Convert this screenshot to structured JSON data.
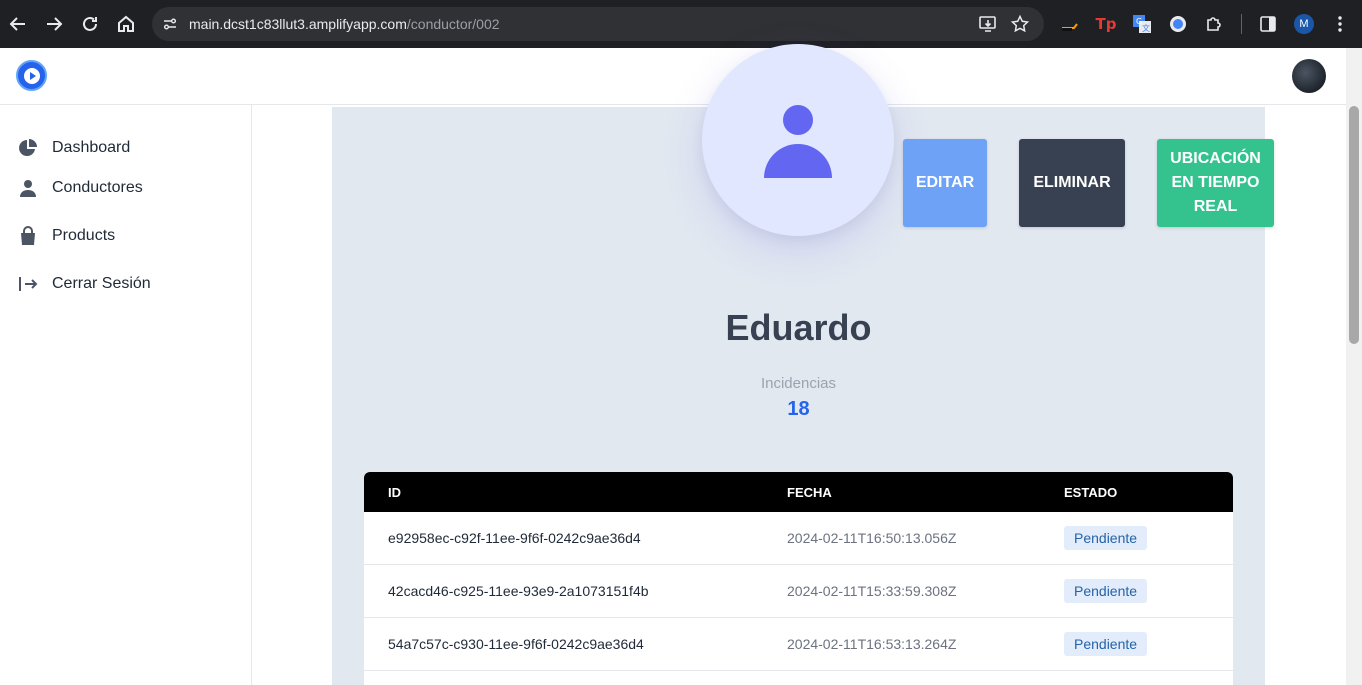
{
  "browser": {
    "url_host": "main.dcst1c83llut3.amplifyapp.com",
    "url_path": "/conductor/002",
    "profile_initial": "M"
  },
  "header": {
    "logo_icon": "play-logo-icon",
    "avatar_icon": "user-avatar"
  },
  "sidebar": {
    "items": [
      {
        "label": "Dashboard",
        "icon": "pie-chart-icon"
      },
      {
        "label": "Conductores",
        "icon": "user-icon"
      },
      {
        "label": "Products",
        "icon": "shopping-bag-icon"
      },
      {
        "label": "Cerrar Sesión",
        "icon": "logout-icon"
      }
    ]
  },
  "driver": {
    "name": "Eduardo",
    "incidents_label": "Incidencias",
    "incidents_value": "18"
  },
  "actions": {
    "edit": "EDITAR",
    "delete": "ELIMINAR",
    "location": "UBICACIÓN EN TIEMPO REAL"
  },
  "table": {
    "headers": [
      "ID",
      "FECHA",
      "ESTADO"
    ],
    "rows": [
      {
        "id": "e92958ec-c92f-11ee-9f6f-0242c9ae36d4",
        "date": "2024-02-11T16:50:13.056Z",
        "status": "Pendiente"
      },
      {
        "id": "42cacd46-c925-11ee-93e9-2a1073151f4b",
        "date": "2024-02-11T15:33:59.308Z",
        "status": "Pendiente"
      },
      {
        "id": "54a7c57c-c930-11ee-9f6f-0242c9ae36d4",
        "date": "2024-02-11T16:53:13.264Z",
        "status": "Pendiente"
      }
    ]
  },
  "colors": {
    "edit": "#6ea2f7",
    "delete": "#374151",
    "location": "#34c38f",
    "accent": "#2563eb"
  }
}
